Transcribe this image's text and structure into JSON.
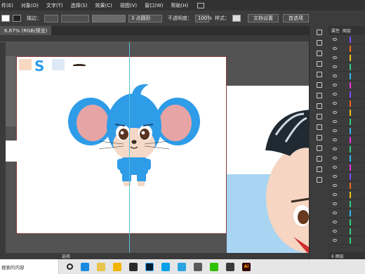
{
  "menu": [
    "件(E)",
    "对象(O)",
    "文字(T)",
    "选择(S)",
    "效果(C)",
    "视图(V)",
    "窗口(W)",
    "帮助(H)"
  ],
  "options": {
    "stroke_label": "描边：",
    "brush_label": "3 点圆形",
    "opacity_label": "不透明度：",
    "opacity_value": "100%",
    "style_label": "样式：",
    "doc_settings": "文档设置",
    "preferences": "首选项"
  },
  "doc_tab": "6.67% (RGB/预览)",
  "status_text": "选择",
  "panel": {
    "tab_properties": "属性",
    "tab_layers": "图层",
    "layer_count": "6 图层"
  },
  "layer_colors": [
    "#7a4cff",
    "#f06a1a",
    "#f0c31a",
    "#2fd07a",
    "#2fb8ee",
    "#f02fe0",
    "#7a4cff",
    "#f06a1a",
    "#f0c31a",
    "#2fd07a",
    "#2fb8ee",
    "#f02fe0",
    "#2fd07a",
    "#2fb8ee",
    "#f02fe0",
    "#7a4cff",
    "#f06a1a",
    "#f0c31a",
    "#2fd07a",
    "#2fb8ee",
    "#2fd07a",
    "#2fd07a",
    "#2fd07a"
  ],
  "taskbar": {
    "search_text": "搜索的内容",
    "app_label": "Ai"
  },
  "colors": {
    "mouse_blue": "#2f9ce8",
    "ear_pink": "#e7a4a4",
    "sky": "#a7d5f2"
  }
}
